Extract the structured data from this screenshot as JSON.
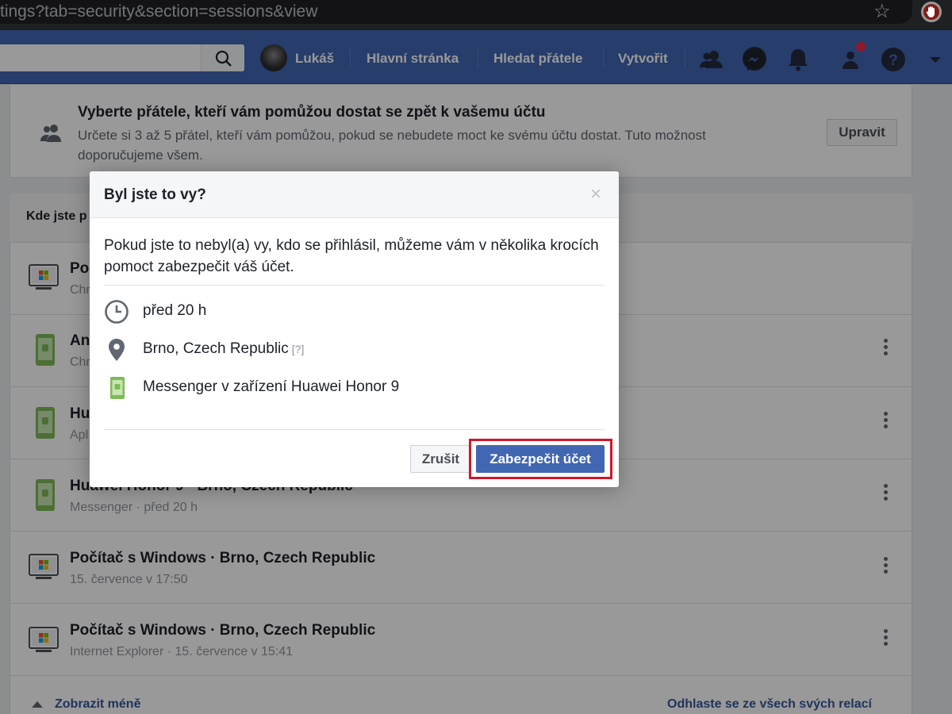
{
  "browser": {
    "url": "tings?tab=security&section=sessions&view"
  },
  "nav": {
    "user_name": "Lukáš",
    "links": [
      "Hlavní stránka",
      "Hledat přátele",
      "Vytvořit"
    ],
    "icons": [
      "friends-icon",
      "messenger-icon",
      "bell-icon",
      "friend-requests-icon",
      "help-icon",
      "dropdown-caret-icon"
    ],
    "color": "#4267b2"
  },
  "trusted_contacts": {
    "title": "Vyberte přátele, kteří vám pomůžou dostat se zpět k vašemu účtu",
    "description": "Určete si 3 až 5 přátel, kteří vám pomůžou, pokud se nebudete moct ke svému účtu dostat. Tuto možnost doporučujeme všem.",
    "edit_label": "Upravit"
  },
  "sessions": {
    "header_label": "Kde jste p",
    "rows": [
      {
        "title": "Po",
        "subtitle": "Chr",
        "device": "windows-pc"
      },
      {
        "title": "An",
        "subtitle": "Chr",
        "device": "android"
      },
      {
        "title": "Hu",
        "subtitle": "Apl",
        "device": "android"
      },
      {
        "title": "Huawei Honor 9 · Brno, Czech Republic",
        "subtitle": "Messenger · před 20 h",
        "device": "android"
      },
      {
        "title": "Počítač s Windows · Brno, Czech Republic",
        "subtitle": "15. července v 17:50",
        "device": "windows-pc"
      },
      {
        "title": "Počítač s Windows · Brno, Czech Republic",
        "subtitle": "Internet Explorer · 15. července v 15:41",
        "device": "windows-pc"
      }
    ],
    "show_less": "Zobrazit méně",
    "logout_all": "Odhlaste se ze všech svých relací"
  },
  "dialog": {
    "title": "Byl jste to vy?",
    "description": "Pokud jste to nebyl(a) vy, kdo se přihlásil, můžeme vám v několika krocích pomoct zabezpečit váš účet.",
    "time": "před 20 h",
    "location": "Brno, Czech Republic",
    "location_help": "[?]",
    "device": "Messenger v zařízení Huawei Honor 9",
    "cancel_label": "Zrušit",
    "secure_label": "Zabezpečit účet",
    "highlight_color": "#d0172a"
  }
}
